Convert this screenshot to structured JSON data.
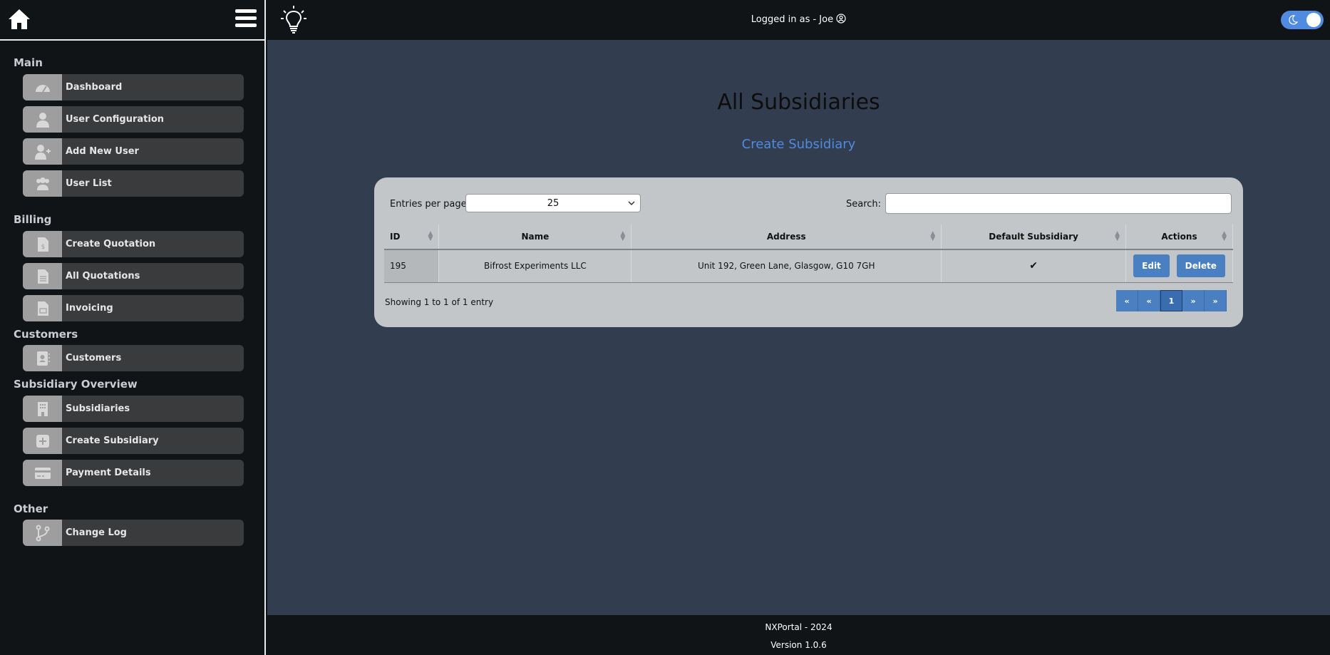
{
  "sidebar": {
    "sections": {
      "main": "Main",
      "billing": "Billing",
      "customers": "Customers",
      "subsidiary": "Subsidiary Overview",
      "other": "Other"
    },
    "items": {
      "dashboard": "Dashboard",
      "user_config": "User Configuration",
      "add_user": "Add New User",
      "user_list": "User List",
      "create_quotation": "Create Quotation",
      "all_quotations": "All Quotations",
      "invoicing": "Invoicing",
      "customers": "Customers",
      "subsidiaries": "Subsidiaries",
      "create_subsidiary": "Create Subsidiary",
      "payment_details": "Payment Details",
      "change_log": "Change Log"
    }
  },
  "header": {
    "logged_in": "Logged in as - Joe"
  },
  "main": {
    "title": "All Subsidiaries",
    "create_link": "Create Subsidiary",
    "entries_label": "Entries per page",
    "entries_value": "25",
    "search_label": "Search:",
    "search_value": "",
    "columns": {
      "id": "ID",
      "name": "Name",
      "address": "Address",
      "default": "Default Subsidiary",
      "actions": "Actions"
    },
    "row": {
      "id": "195",
      "name": "Bifrost Experiments LLC",
      "address": "Unit 192, Green Lane, Glasgow, G10 7GH",
      "default_mark": "✔",
      "edit": "Edit",
      "delete": "Delete"
    },
    "showing": "Showing 1 to 1 of 1 entry",
    "pager": {
      "first": "«",
      "prev": "«",
      "page": "1",
      "next": "»",
      "last": "»"
    }
  },
  "footer": {
    "brand": "NXPortal - 2024",
    "version": "Version 1.0.6"
  },
  "colors": {
    "accent": "#4f8be0",
    "content_bg": "#323d50",
    "card_bg": "#c3c6c9",
    "button": "#4a7fc1"
  },
  "icons": [
    "home-icon",
    "menu-icon",
    "bulb-icon",
    "user-circle-icon",
    "moon-icon",
    "dashboard-icon",
    "user-icon",
    "user-plus-icon",
    "users-icon",
    "invoice-dollar-icon",
    "document-icon",
    "receipt-icon",
    "address-book-icon",
    "building-icon",
    "plus-square-icon",
    "credit-card-icon",
    "git-branch-icon",
    "chevron-down-icon",
    "check-icon"
  ]
}
